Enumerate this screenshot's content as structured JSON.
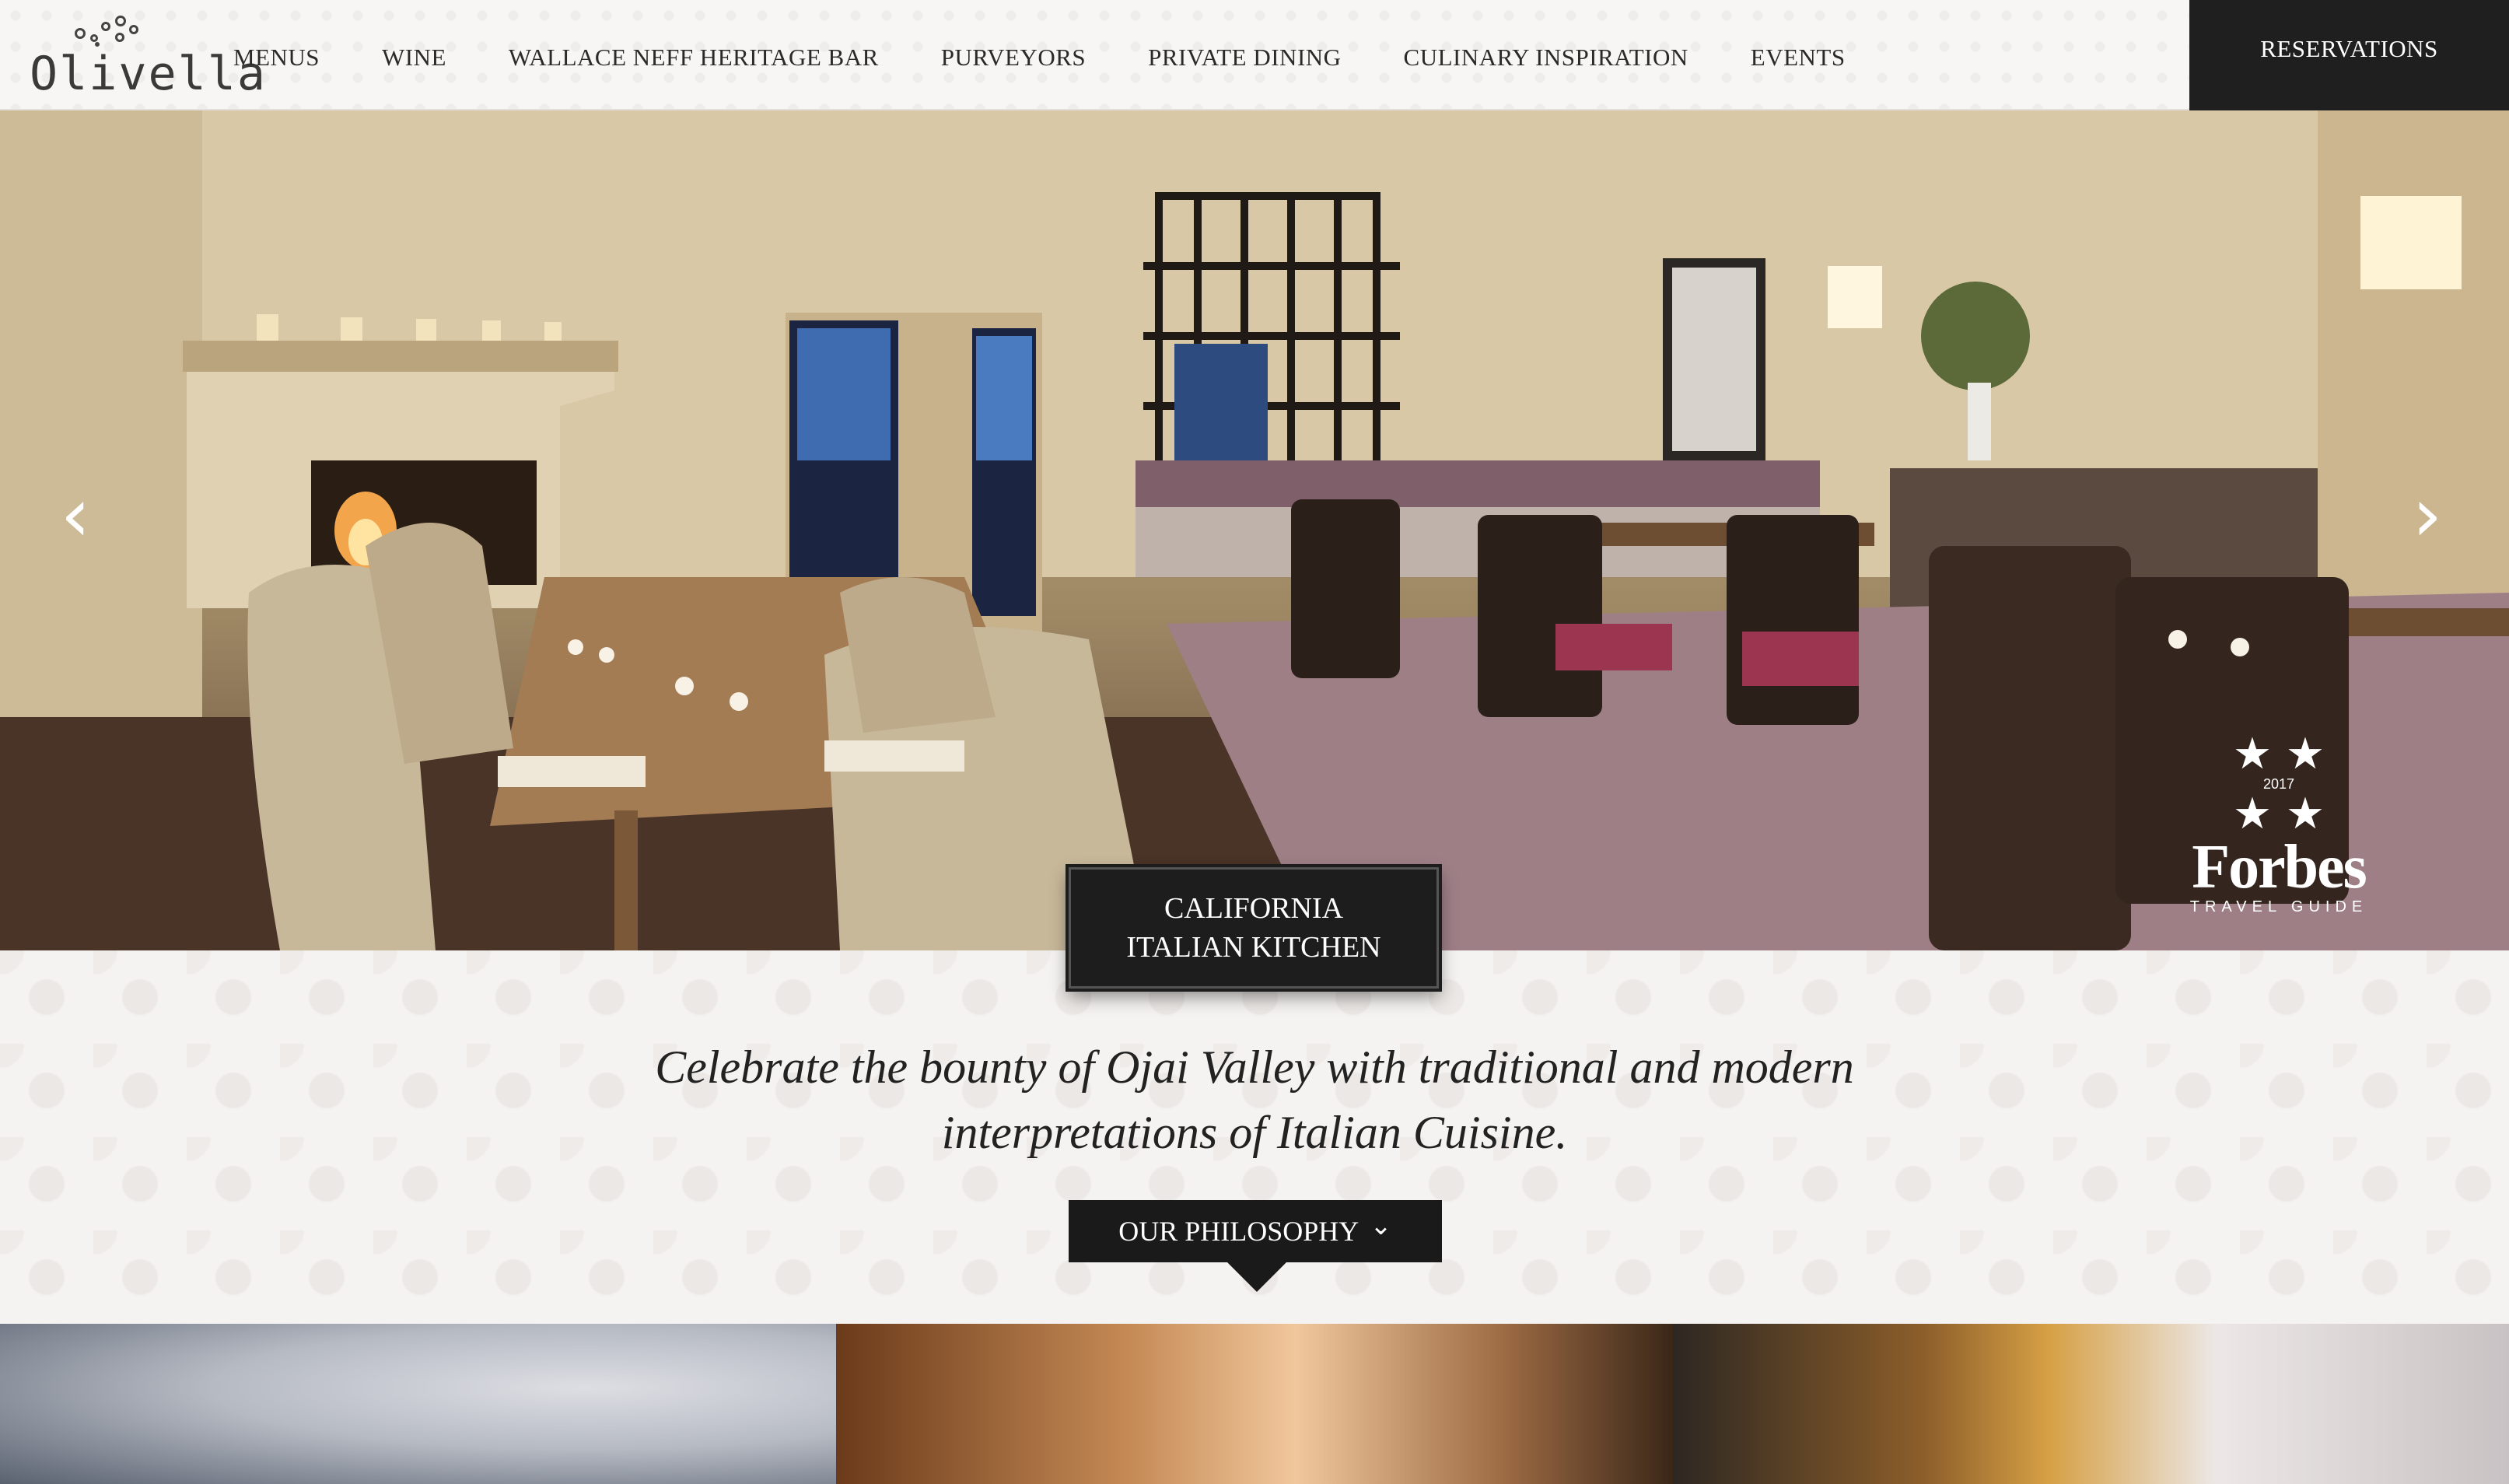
{
  "header": {
    "logo_text": "Olivella",
    "nav": [
      "MENUS",
      "WINE",
      "WALLACE NEFF HERITAGE BAR",
      "PURVEYORS",
      "PRIVATE DINING",
      "CULINARY INSPIRATION",
      "EVENTS"
    ],
    "reservations_label": "RESERVATIONS"
  },
  "hero": {
    "prev_arrow": "‹",
    "next_arrow": "›",
    "tagline_line1": "CALIFORNIA",
    "tagline_line2": "ITALIAN KITCHEN",
    "badge": {
      "year": "2017",
      "brand": "Forbes",
      "subtitle": "TRAVEL GUIDE"
    }
  },
  "intro": {
    "line1": "Celebrate the bounty of Ojai Valley with traditional and modern",
    "line2": "interpretations of Italian Cuisine."
  },
  "philosophy_button": {
    "label": "OUR PHILOSOPHY",
    "chevron": "⌄"
  },
  "colors": {
    "dark": "#1d1d1d",
    "background": "#f5f3f1"
  }
}
